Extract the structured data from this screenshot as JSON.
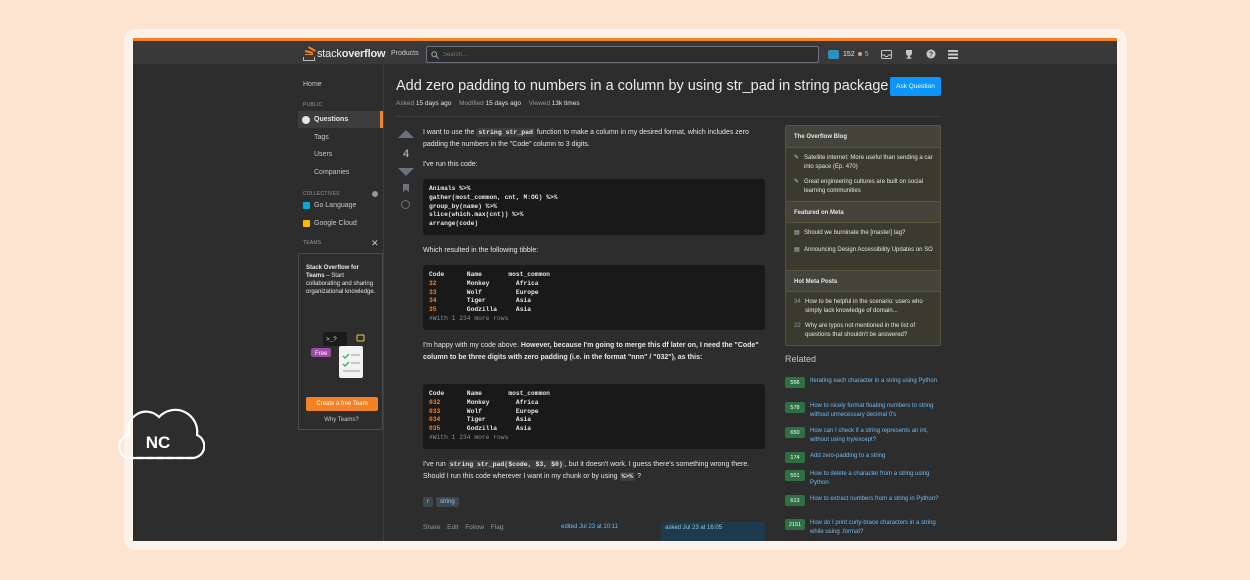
{
  "brand": {
    "name_plain": "stack",
    "name_bold": "overflow"
  },
  "topbar": {
    "products": "Products",
    "search_placeholder": "Search...",
    "reputation": "152",
    "badge_bronze": "5"
  },
  "left_nav": {
    "home": "Home",
    "public_label": "PUBLIC",
    "questions": "Questions",
    "tags": "Tags",
    "users": "Users",
    "companies": "Companies",
    "collectives_label": "COLLECTIVES",
    "collectives": [
      "Go Language",
      "Google Cloud"
    ],
    "teams_label": "TEAMS",
    "teams_title": "Stack Overflow for Teams",
    "teams_desc": " – Start collaborating and sharing organizational knowledge.",
    "teams_free": "Free",
    "teams_button": "Create a free Team",
    "why_teams": "Why Teams?"
  },
  "question": {
    "title": "Add zero padding to numbers in a column by using str_pad in string package",
    "ask_button": "Ask Question",
    "asked_label": "Asked",
    "asked_value": "15 days ago",
    "modified_label": "Modified",
    "modified_value": "15 days ago",
    "viewed_label": "Viewed",
    "viewed_value": "13k times",
    "votes": "4",
    "p1_before": "I want to use the ",
    "p1_code": "string str_pad",
    "p1_after": " function to make a column in my desired format, which includes zero padding the numbers in the \"Code\" column to 3 digits.",
    "p2": "I've run this code:",
    "code1": [
      "Animals %>%",
      "gather(most_common, cnt, M:OG) %>%",
      "group_by(name) %>%",
      "slice(which.max(cnt)) %>%",
      "arrange(code)"
    ],
    "p3": "Which resulted in the following tibble:",
    "table1_header": "Code      Name       most_common",
    "table1_rows": [
      {
        "code": "32",
        "rest": "        Monkey       Africa"
      },
      {
        "code": "33",
        "rest": "        Wolf         Europe"
      },
      {
        "code": "34",
        "rest": "        Tiger        Asia"
      },
      {
        "code": "35",
        "rest": "        Godzilla     Asia"
      }
    ],
    "table1_footer": "#With 1 234 more rows",
    "p4_plain": "I'm happy with my code above. ",
    "p4_bold": "However, because I'm going to merge this df later on, I need the \"Code\" column to be three digits with zero padding (i.e. in the format \"nnn\" / \"032\"), as this:",
    "table2_header": "Code      Name       most_common",
    "table2_rows": [
      {
        "code": "032",
        "rest": "       Monkey       Africa"
      },
      {
        "code": "033",
        "rest": "       Wolf         Europe"
      },
      {
        "code": "034",
        "rest": "       Tiger        Asia"
      },
      {
        "code": "035",
        "rest": "       Godzilla     Asia"
      }
    ],
    "table2_footer": "#With 1 234 more rows",
    "p5_before": "I've run ",
    "p5_code": "string str_pad($code, $3, $0)",
    "p5_mid": ", but it doesn't work. I guess there's something wrong there. Should I run this code wherever I want in my chunk or by using ",
    "p5_code2": "%>%",
    "p5_after": " ?",
    "tags": [
      "r",
      "string"
    ],
    "actions": [
      "Share",
      "Edit",
      "Follow",
      "Flag"
    ],
    "edited": "edited Jul 23 at 10:11",
    "asked_card": "asked Jul 23 at 16:05"
  },
  "sidebar": {
    "blog_title": "The Overflow Blog",
    "blog_items": [
      "Satellite internet: More useful than sending a car into space (Ep. 470)",
      "Great engineering cultures are built on social learning communities"
    ],
    "meta_title": "Featured on Meta",
    "meta_items": [
      "Should we burninate the [master] tag?",
      "Announcing Design Accessibility Updates on SO"
    ],
    "hot_title": "Hot Meta Posts",
    "hot_items": [
      {
        "count": "34",
        "text": "How to be helpful in the scenario: users who simply lack knowledge of domain..."
      },
      {
        "count": "22",
        "text": "Why are typos not mentioned in the list of questions that shouldn't be answered?"
      }
    ],
    "related_title": "Related",
    "related": [
      {
        "count": "556",
        "text": "Iterating each character in a string using Python"
      },
      {
        "count": "578",
        "text": "How to nicely format floating numbers to string without unnecessary decimal 0's"
      },
      {
        "count": "650",
        "text": "How can I check if a string represents an int, without using try/except?"
      },
      {
        "count": "174",
        "text": "Add zero-padding to a string"
      },
      {
        "count": "551",
        "text": "How to delete a character from a string using Python"
      },
      {
        "count": "613",
        "text": "How to extract numbers from a string in Python?"
      },
      {
        "count": "2151",
        "text": "How do I print curly-brace characters in a string while using .format?"
      }
    ]
  },
  "watermark": {
    "text": "NC"
  },
  "colors": {
    "accent": "#f48225",
    "link": "#6cbbf7",
    "button": "#0a95ff",
    "answered": "#2f6f44"
  }
}
